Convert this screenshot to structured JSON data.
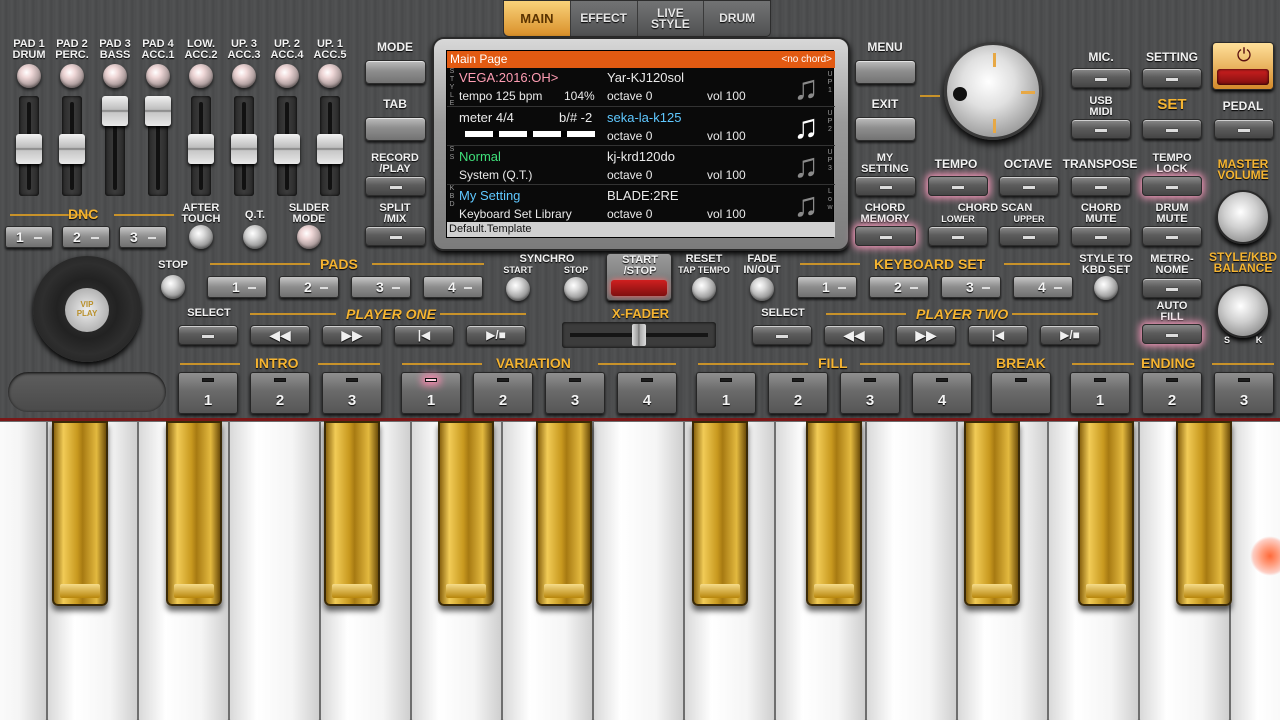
{
  "tabs": [
    {
      "label": "MAIN",
      "active": true
    },
    {
      "label": "EFFECT"
    },
    {
      "label": "LIVE\nSTYLE"
    },
    {
      "label": "DRUM"
    }
  ],
  "pads": [
    {
      "top": "PAD 1",
      "bottom": "DRUM"
    },
    {
      "top": "PAD 2",
      "bottom": "PERC."
    },
    {
      "top": "PAD 3",
      "bottom": "BASS"
    },
    {
      "top": "PAD 4",
      "bottom": "ACC.1"
    },
    {
      "top": "LOW.",
      "bottom": "ACC.2"
    },
    {
      "top": "UP. 3",
      "bottom": "ACC.3"
    },
    {
      "top": "UP. 2",
      "bottom": "ACC.4"
    },
    {
      "top": "UP. 1",
      "bottom": "ACC.5"
    }
  ],
  "slider_levels": [
    0.0,
    0.0,
    1.0,
    1.0,
    0.0,
    0.0,
    0.0,
    0.0
  ],
  "dnc": {
    "title": "DNC",
    "buttons": [
      "1",
      "2",
      "3"
    ],
    "after_touch": "AFTER\nTOUCH",
    "qt": "Q.T.",
    "slider_mode": "SLIDER\nMODE"
  },
  "left_menu": {
    "mode": "MODE",
    "tab": "TAB",
    "record": "RECORD\n/PLAY",
    "split": "SPLIT\n/MIX"
  },
  "right_menu": {
    "menu": "MENU",
    "exit": "EXIT",
    "my_setting": "MY\nSETTING",
    "chord_memory": "CHORD\nMEMORY"
  },
  "screen": {
    "header": "Main Page",
    "chord": "<no chord>",
    "rows": [
      {
        "side": "S\nT\nY\nL\nE",
        "left1": "VEGA:2016:OH>",
        "left2": "tempo 125 bpm",
        "pct": "104%",
        "right1": "Yar-KJ120sol",
        "octave": "octave  0",
        "vol": "vol 100",
        "side2": "U\nP\n1"
      },
      {
        "side": "",
        "left1": "meter 4/4",
        "bsharp": "b/#  -2",
        "right1": "seka-la-k125",
        "octave": "octave  0",
        "vol": "vol 100",
        "side2": "U\nP\n2"
      },
      {
        "side": "S\nS",
        "left1": "Normal",
        "left2": "System (Q.T.)",
        "right1": "kj-krd120do",
        "octave": "octave  0",
        "vol": "vol 100",
        "side2": "U\nP\n3"
      },
      {
        "side": "K\nB\nD",
        "left1": "My Setting",
        "left2": "Keyboard Set Library",
        "right1": "BLADE:2RE",
        "octave": "octave  0",
        "vol": "vol 100",
        "side2": "L\no\nw"
      }
    ],
    "footer": "Default.Template"
  },
  "top_right": {
    "mic": "MIC.",
    "setting": "SETTING",
    "usb_midi": "USB\nMIDI",
    "set": "SET",
    "pedal": "PEDAL"
  },
  "row2": {
    "tempo": "TEMPO",
    "octave": "OCTAVE",
    "transpose": "TRANSPOSE",
    "tempo_lock": "TEMPO\nLOCK",
    "master_volume": "MASTER\nVOLUME",
    "chord_scan": "CHORD SCAN",
    "lower": "LOWER",
    "upper": "UPPER",
    "chord_mute": "CHORD\nMUTE",
    "drum_mute": "DRUM\nMUTE"
  },
  "style_kbd": {
    "label": "STYLE/KBD\nBALANCE",
    "s": "S",
    "k": "K",
    "minus": "-",
    "plus": "+"
  },
  "pads_row": {
    "stop": "STOP",
    "title": "PADS",
    "buttons": [
      "1",
      "2",
      "3",
      "4"
    ]
  },
  "synchro": {
    "title": "SYNCHRO",
    "start": "START",
    "stop": "STOP"
  },
  "start_stop": "START\n/STOP",
  "reset": {
    "title": "RESET",
    "sub": "TAP TEMPO"
  },
  "fade": "FADE\nIN/OUT",
  "keyboard_set": {
    "title": "KEYBOARD SET",
    "buttons": [
      "1",
      "2",
      "3",
      "4"
    ],
    "style_to_kbd": "STYLE TO\nKBD SET"
  },
  "metronome": "METRO-\nNOME",
  "auto_fill": "AUTO\nFILL",
  "player_one": {
    "select": "SELECT",
    "title": "PLAYER ONE"
  },
  "player_two": {
    "select": "SELECT",
    "title": "PLAYER TWO"
  },
  "xfader": "X-FADER",
  "disc": {
    "label": "VIP\nPLAY"
  },
  "sections": {
    "intro": "INTRO",
    "variation": "VARIATION",
    "fill": "FILL",
    "break": "BREAK",
    "ending": "ENDING"
  },
  "section_buttons": [
    {
      "num": "1"
    },
    {
      "num": "2"
    },
    {
      "num": "3"
    },
    {
      "num": "1",
      "lit": true
    },
    {
      "num": "2"
    },
    {
      "num": "3"
    },
    {
      "num": "4"
    },
    {
      "num": "1"
    },
    {
      "num": "2"
    },
    {
      "num": "3"
    },
    {
      "num": "4"
    },
    {
      "num": ""
    },
    {
      "num": "1"
    },
    {
      "num": "2"
    },
    {
      "num": "3"
    }
  ]
}
